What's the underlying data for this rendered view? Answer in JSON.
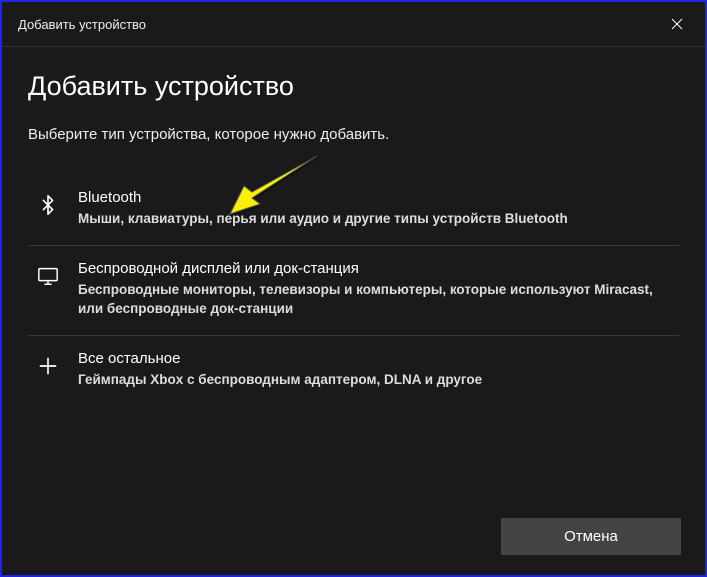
{
  "titlebar": {
    "title": "Добавить устройство"
  },
  "heading": "Добавить устройство",
  "subheading": "Выберите тип устройства, которое нужно добавить.",
  "options": [
    {
      "title": "Bluetooth",
      "desc": "Мыши, клавиатуры, перья или аудио и другие типы устройств Bluetooth"
    },
    {
      "title": "Беспроводной дисплей или док-станция",
      "desc": "Беспроводные мониторы, телевизоры и компьютеры, которые используют Miracast, или беспроводные док-станции"
    },
    {
      "title": "Все остальное",
      "desc": "Геймпады Xbox с беспроводным адаптером, DLNA и другое"
    }
  ],
  "footer": {
    "cancel_label": "Отмена"
  }
}
